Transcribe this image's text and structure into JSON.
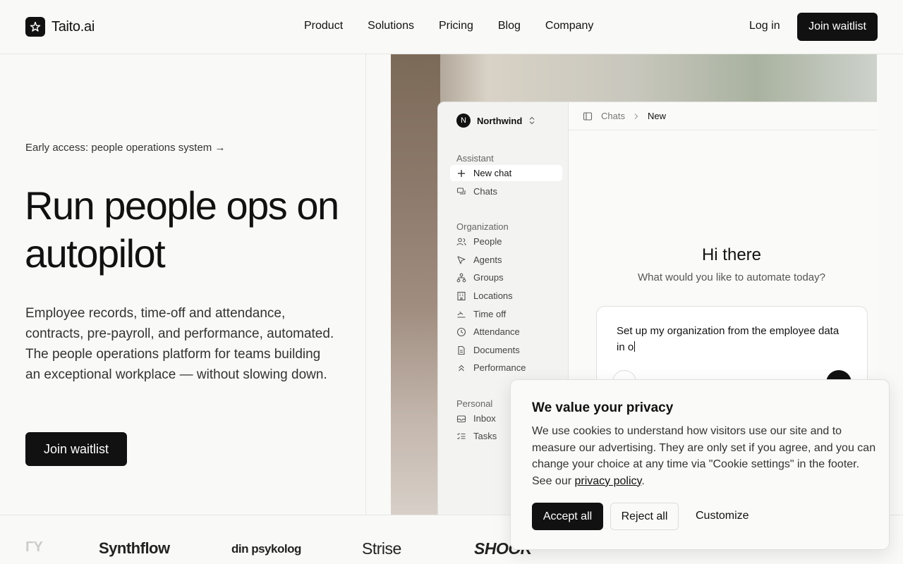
{
  "header": {
    "brand": "Taito.ai",
    "nav": [
      "Product",
      "Solutions",
      "Pricing",
      "Blog",
      "Company"
    ],
    "login": "Log in",
    "cta": "Join waitlist"
  },
  "hero": {
    "eyebrow": "Early access: people operations system →",
    "title": "Run people ops on autopilot",
    "description": "Employee records, time-off and attendance, contracts, pre-payroll, and performance, automated. The people operations platform for teams building an exceptional workplace — without slowing down.",
    "cta": "Join waitlist"
  },
  "app": {
    "org": {
      "initial": "N",
      "name": "Northwind"
    },
    "sections": {
      "assistant": "Assistant",
      "organization": "Organization",
      "personal": "Personal"
    },
    "assistant_items": [
      {
        "label": "New chat",
        "icon": "plus-icon"
      },
      {
        "label": "Chats",
        "icon": "chats-icon"
      }
    ],
    "organization_items": [
      {
        "label": "People",
        "icon": "people-icon"
      },
      {
        "label": "Agents",
        "icon": "cursor-icon"
      },
      {
        "label": "Groups",
        "icon": "groups-icon"
      },
      {
        "label": "Locations",
        "icon": "building-icon"
      },
      {
        "label": "Time off",
        "icon": "timeoff-icon"
      },
      {
        "label": "Attendance",
        "icon": "clock-icon"
      },
      {
        "label": "Documents",
        "icon": "document-icon"
      },
      {
        "label": "Performance",
        "icon": "chevrons-up-icon"
      }
    ],
    "personal_items": [
      {
        "label": "Inbox",
        "icon": "inbox-icon"
      },
      {
        "label": "Tasks",
        "icon": "tasks-icon"
      }
    ],
    "breadcrumb": [
      "Chats",
      "New"
    ],
    "greeting": "Hi there",
    "subgreeting": "What would you like to automate today?",
    "prompt_value": "Set up my organization from the employee data in o"
  },
  "logos": [
    "Synthflow",
    "din psykolog",
    "Strise",
    "SHOOK"
  ],
  "cookie": {
    "title": "We value your privacy",
    "body": "We use cookies to understand how visitors use our site and to measure our advertising. They are only set if you agree, and you can change your choice at any time via \"Cookie settings\" in the footer. See our ",
    "link": "privacy policy",
    "accept": "Accept all",
    "reject": "Reject all",
    "customize": "Customize"
  }
}
